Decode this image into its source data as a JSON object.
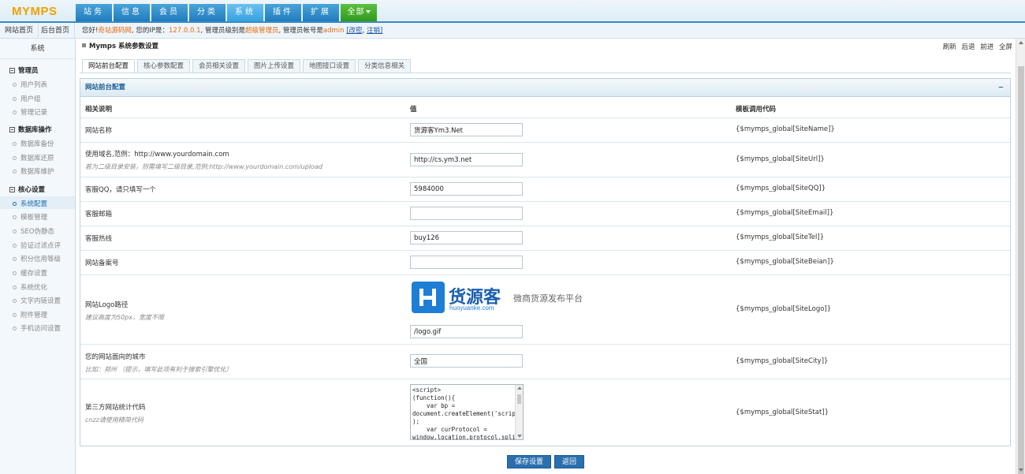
{
  "header": {
    "logo": "MYMPS",
    "nav": [
      "站务",
      "信息",
      "会员",
      "分类",
      "系统",
      "插件",
      "扩展"
    ],
    "nav_all": "全部"
  },
  "subbar": {
    "site_home": "网站首页",
    "admin_home": "后台首页",
    "welcome_prefix": "您好!",
    "site_name": "奇站源码网",
    "ip_label": ", 您的IP是：",
    "ip": "127.0.0.1",
    "level_label": ", 管理员级别是",
    "level": "超级管理员",
    "account_label": ", 管理员帐号是",
    "account": "admin",
    "change_link": "[改密",
    "sep": ", ",
    "logout_link": "注销]"
  },
  "sidebar": {
    "title": "系统",
    "groups": [
      {
        "label": "管理员",
        "items": [
          "用户列表",
          "用户组",
          "管理记录"
        ]
      },
      {
        "label": "数据库操作",
        "items": [
          "数据库备份",
          "数据库还原",
          "数据库维护"
        ]
      },
      {
        "label": "核心设置",
        "items": [
          "系统配置",
          "模板管理",
          "SEO伪静态",
          "验证过滤点评",
          "积分信用等级",
          "缓存设置",
          "系统优化",
          "文字内链设置",
          "附件管理",
          "手机访问设置"
        ]
      }
    ]
  },
  "main": {
    "title": "Mymps 系统参数设置",
    "right_links": [
      "刷新",
      "后退",
      "前进",
      "全屏"
    ],
    "tabs": [
      "网站前台配置",
      "核心参数配置",
      "会员相关设置",
      "图片上传设置",
      "地图接口设置",
      "分类信息相关"
    ],
    "panel_title": "网站前台配置",
    "collapse": "−",
    "columns": [
      "相关说明",
      "值",
      "模板调用代码"
    ],
    "rows": [
      {
        "label": "网站名称",
        "hint": "",
        "value": "货源客Ym3.Net",
        "code": "{$mymps_global[SiteName]}"
      },
      {
        "label": "使用域名,范例：http://www.yourdomain.com",
        "hint": "若为二级目录安装，则需填写二级目录,范例:http://www.yourdomain.com/upload",
        "value": "http://cs.ym3.net",
        "code": "{$mymps_global[SiteUrl]}"
      },
      {
        "label": "客服QQ，请只填写一个",
        "hint": "",
        "value": "5984000",
        "code": "{$mymps_global[SiteQQ]}"
      },
      {
        "label": "客服邮箱",
        "hint": "",
        "value": "",
        "code": "{$mymps_global[SiteEmail]}"
      },
      {
        "label": "客服热线",
        "hint": "",
        "value": "buy126",
        "code": "{$mymps_global[SiteTel]}"
      },
      {
        "label": "网站备案号",
        "hint": "",
        "value": "",
        "code": "{$mymps_global[SiteBeian]}"
      },
      {
        "label": "网站Logo路径",
        "hint": "建议高度为50px，宽度不限",
        "value": "/logo.gif",
        "code": "{$mymps_global[SiteLogo]}"
      },
      {
        "label": "您的网站面向的城市",
        "hint": "比如：郑州 （提示，填写此项有利于搜索引擎优化）",
        "value": "全国",
        "code": "{$mymps_global[SiteCity]}"
      },
      {
        "label": "第三方网站统计代码",
        "hint": "cnzz请使用精简代码",
        "value": "<script>\n(function(){\n    var bp =\ndocument.createElement('script'\n);\n    var curProtocol =\nwindow.location.protocol.split(\n':')[",
        "code": "{$mymps_global[SiteStat]}"
      }
    ],
    "logo_preview": {
      "name": "货源客",
      "domain": "huoyuanke.com",
      "slogan": "微商货源发布平台"
    },
    "buttons": {
      "save": "保存设置",
      "back": "返回"
    }
  }
}
